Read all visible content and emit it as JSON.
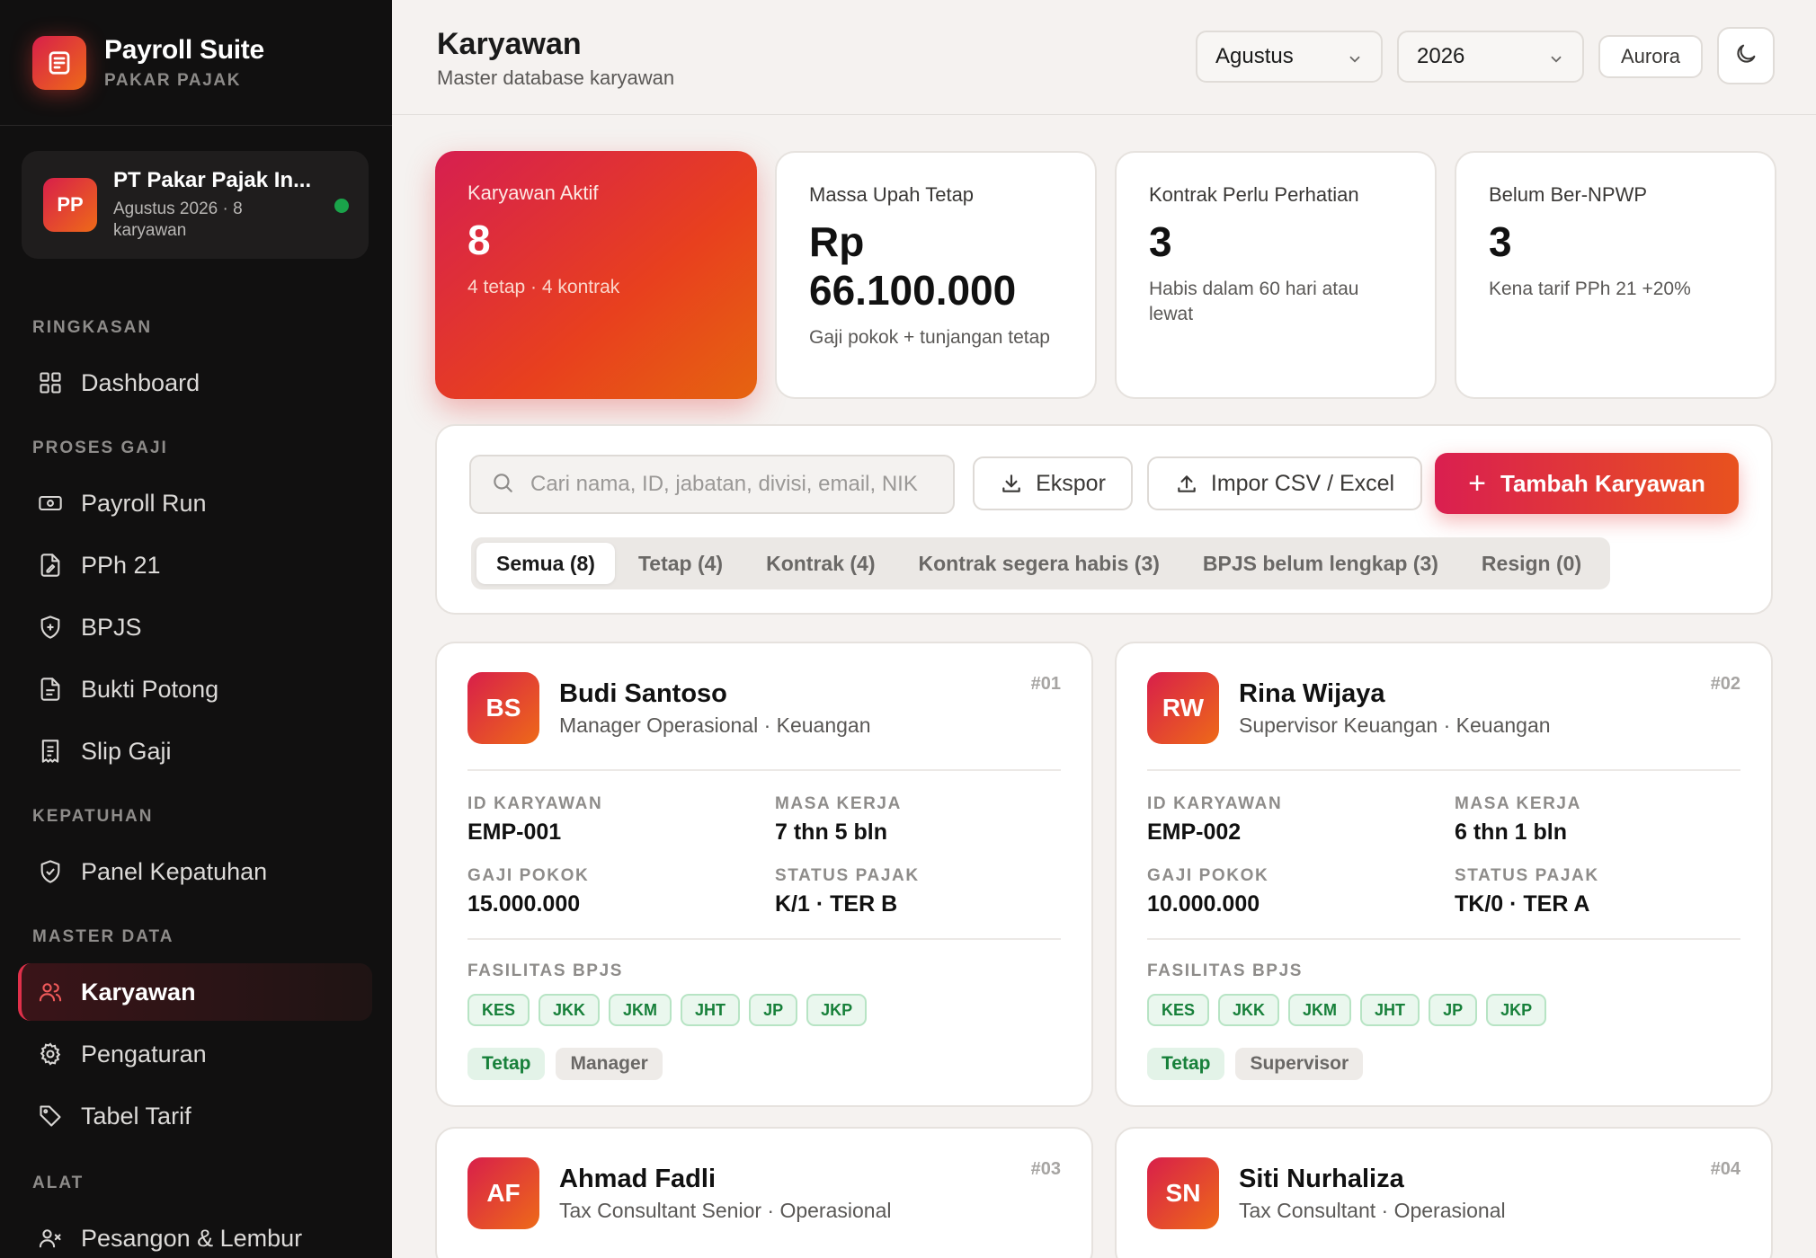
{
  "brand": {
    "title": "Payroll Suite",
    "subtitle": "PAKAR PAJAK"
  },
  "company": {
    "initials": "PP",
    "name": "PT Pakar Pajak In...",
    "meta": "Agustus 2026 · 8 karyawan"
  },
  "nav": {
    "ringkasan": "RINGKASAN",
    "dashboard": "Dashboard",
    "proses_gaji": "PROSES GAJI",
    "payroll_run": "Payroll Run",
    "pph21": "PPh 21",
    "bpjs": "BPJS",
    "bukti_potong": "Bukti Potong",
    "slip_gaji": "Slip Gaji",
    "kepatuhan": "KEPATUHAN",
    "panel_kepatuhan": "Panel Kepatuhan",
    "master_data": "MASTER DATA",
    "karyawan": "Karyawan",
    "pengaturan": "Pengaturan",
    "tabel_tarif": "Tabel Tarif",
    "alat": "ALAT",
    "pesangon": "Pesangon & Lembur"
  },
  "header": {
    "title": "Karyawan",
    "subtitle": "Master database karyawan",
    "month": "Agustus",
    "year": "2026",
    "theme_label": "Aurora"
  },
  "stats": [
    {
      "label": "Karyawan Aktif",
      "value": "8",
      "sub": "4 tetap · 4 kontrak"
    },
    {
      "label": "Massa Upah Tetap",
      "value": "Rp 66.100.000",
      "sub": "Gaji pokok + tunjangan tetap"
    },
    {
      "label": "Kontrak Perlu Perhatian",
      "value": "3",
      "sub": "Habis dalam 60 hari atau lewat"
    },
    {
      "label": "Belum Ber-NPWP",
      "value": "3",
      "sub": "Kena tarif PPh 21 +20%"
    }
  ],
  "toolbar": {
    "search_placeholder": "Cari nama, ID, jabatan, divisi, email, NIK",
    "export": "Ekspor",
    "import": "Impor CSV / Excel",
    "add": "Tambah Karyawan"
  },
  "filters": [
    "Semua (8)",
    "Tetap (4)",
    "Kontrak (4)",
    "Kontrak segera habis (3)",
    "BPJS belum lengkap (3)",
    "Resign (0)"
  ],
  "field_labels": {
    "id": "ID KARYAWAN",
    "tenure": "MASA KERJA",
    "salary": "GAJI POKOK",
    "tax": "STATUS PAJAK",
    "bpjs": "FASILITAS BPJS"
  },
  "employees": [
    {
      "initials": "BS",
      "name": "Budi Santoso",
      "role": "Manager Operasional · Keuangan",
      "no": "#01",
      "id": "EMP-001",
      "tenure": "7 thn 5 bln",
      "salary": "15.000.000",
      "tax": "K/1 · TER B",
      "bpjs": [
        "KES",
        "JKK",
        "JKM",
        "JHT",
        "JP",
        "JKP"
      ],
      "tags": [
        "Tetap",
        "Manager"
      ]
    },
    {
      "initials": "RW",
      "name": "Rina Wijaya",
      "role": "Supervisor Keuangan · Keuangan",
      "no": "#02",
      "id": "EMP-002",
      "tenure": "6 thn 1 bln",
      "salary": "10.000.000",
      "tax": "TK/0 · TER A",
      "bpjs": [
        "KES",
        "JKK",
        "JKM",
        "JHT",
        "JP",
        "JKP"
      ],
      "tags": [
        "Tetap",
        "Supervisor"
      ]
    },
    {
      "initials": "AF",
      "name": "Ahmad Fadli",
      "role": "Tax Consultant Senior · Operasional",
      "no": "#03"
    },
    {
      "initials": "SN",
      "name": "Siti Nurhaliza",
      "role": "Tax Consultant · Operasional",
      "no": "#04"
    }
  ],
  "colors": {
    "accent_start": "#d81f4a",
    "accent_end": "#ee6a18",
    "sidebar": "#111010",
    "bpjs_green": "#17803a"
  }
}
